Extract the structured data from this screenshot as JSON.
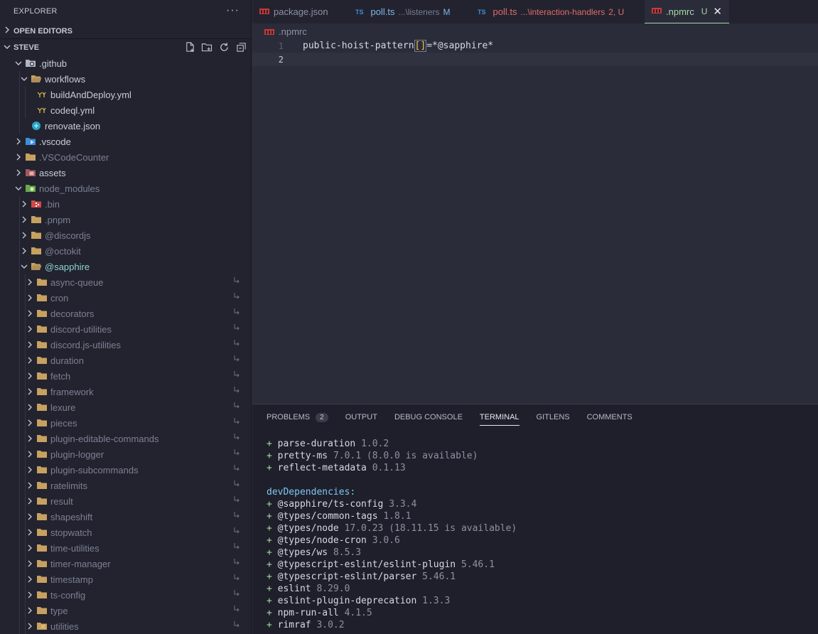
{
  "explorer": {
    "title": "EXPLORER",
    "more": "···",
    "open_editors": "OPEN EDITORS",
    "workspace": "STEVE"
  },
  "tree": [
    {
      "label": ".github",
      "depth": 0,
      "expanded": true,
      "kind": "folder-github",
      "style": "normal"
    },
    {
      "label": "workflows",
      "depth": 1,
      "expanded": true,
      "kind": "folder",
      "style": "normal"
    },
    {
      "label": "buildAndDeploy.yml",
      "depth": 2,
      "kind": "yaml",
      "style": "normal"
    },
    {
      "label": "codeql.yml",
      "depth": 2,
      "kind": "yaml",
      "style": "normal"
    },
    {
      "label": "renovate.json",
      "depth": 1,
      "kind": "renovate",
      "style": "normal"
    },
    {
      "label": ".vscode",
      "depth": 0,
      "expanded": false,
      "kind": "folder-vscode",
      "style": "normal"
    },
    {
      "label": ".VSCodeCounter",
      "depth": 0,
      "expanded": false,
      "kind": "folder",
      "style": "dim"
    },
    {
      "label": "assets",
      "depth": 0,
      "expanded": false,
      "kind": "folder-assets",
      "style": "normal"
    },
    {
      "label": "node_modules",
      "depth": 0,
      "expanded": true,
      "kind": "folder-node",
      "style": "dim"
    },
    {
      "label": ".bin",
      "depth": 1,
      "expanded": false,
      "kind": "folder-bin",
      "style": "dim"
    },
    {
      "label": ".pnpm",
      "depth": 1,
      "expanded": false,
      "kind": "folder",
      "style": "dim"
    },
    {
      "label": "@discordjs",
      "depth": 1,
      "expanded": false,
      "kind": "folder",
      "style": "dim"
    },
    {
      "label": "@octokit",
      "depth": 1,
      "expanded": false,
      "kind": "folder",
      "style": "dim"
    },
    {
      "label": "@sapphire",
      "depth": 1,
      "expanded": true,
      "kind": "folder",
      "style": "teal"
    },
    {
      "label": "async-queue",
      "depth": 2,
      "expanded": false,
      "kind": "folder",
      "style": "dim",
      "link": true
    },
    {
      "label": "cron",
      "depth": 2,
      "expanded": false,
      "kind": "folder",
      "style": "dim",
      "link": true
    },
    {
      "label": "decorators",
      "depth": 2,
      "expanded": false,
      "kind": "folder",
      "style": "dim",
      "link": true
    },
    {
      "label": "discord-utilities",
      "depth": 2,
      "expanded": false,
      "kind": "folder",
      "style": "dim",
      "link": true
    },
    {
      "label": "discord.js-utilities",
      "depth": 2,
      "expanded": false,
      "kind": "folder",
      "style": "dim",
      "link": true
    },
    {
      "label": "duration",
      "depth": 2,
      "expanded": false,
      "kind": "folder",
      "style": "dim",
      "link": true
    },
    {
      "label": "fetch",
      "depth": 2,
      "expanded": false,
      "kind": "folder",
      "style": "dim",
      "link": true
    },
    {
      "label": "framework",
      "depth": 2,
      "expanded": false,
      "kind": "folder",
      "style": "dim",
      "link": true
    },
    {
      "label": "lexure",
      "depth": 2,
      "expanded": false,
      "kind": "folder",
      "style": "dim",
      "link": true
    },
    {
      "label": "pieces",
      "depth": 2,
      "expanded": false,
      "kind": "folder",
      "style": "dim",
      "link": true
    },
    {
      "label": "plugin-editable-commands",
      "depth": 2,
      "expanded": false,
      "kind": "folder",
      "style": "dim",
      "link": true
    },
    {
      "label": "plugin-logger",
      "depth": 2,
      "expanded": false,
      "kind": "folder",
      "style": "dim",
      "link": true
    },
    {
      "label": "plugin-subcommands",
      "depth": 2,
      "expanded": false,
      "kind": "folder",
      "style": "dim",
      "link": true
    },
    {
      "label": "ratelimits",
      "depth": 2,
      "expanded": false,
      "kind": "folder",
      "style": "dim",
      "link": true
    },
    {
      "label": "result",
      "depth": 2,
      "expanded": false,
      "kind": "folder",
      "style": "dim",
      "link": true
    },
    {
      "label": "shapeshift",
      "depth": 2,
      "expanded": false,
      "kind": "folder",
      "style": "dim",
      "link": true
    },
    {
      "label": "stopwatch",
      "depth": 2,
      "expanded": false,
      "kind": "folder",
      "style": "dim",
      "link": true
    },
    {
      "label": "time-utilities",
      "depth": 2,
      "expanded": false,
      "kind": "folder",
      "style": "dim",
      "link": true
    },
    {
      "label": "timer-manager",
      "depth": 2,
      "expanded": false,
      "kind": "folder",
      "style": "dim",
      "link": true
    },
    {
      "label": "timestamp",
      "depth": 2,
      "expanded": false,
      "kind": "folder",
      "style": "dim",
      "link": true
    },
    {
      "label": "ts-config",
      "depth": 2,
      "expanded": false,
      "kind": "folder",
      "style": "dim",
      "link": true
    },
    {
      "label": "type",
      "depth": 2,
      "expanded": false,
      "kind": "folder",
      "style": "dim",
      "link": true
    },
    {
      "label": "utilities",
      "depth": 2,
      "expanded": false,
      "kind": "folder-utils",
      "style": "dim",
      "link": true
    }
  ],
  "tabs": [
    {
      "label": "package.json",
      "icon": "npm",
      "desc": "",
      "badge": "",
      "active": false
    },
    {
      "label": "poll.ts",
      "icon": "TS",
      "desc": "...\\listeners",
      "badge": "M",
      "active": false,
      "color": "#7fb6e8",
      "badge_color": "#7fb6e8"
    },
    {
      "label": "poll.ts",
      "icon": "TS",
      "desc": "...\\interaction-handlers",
      "badge": "2, U",
      "active": false,
      "color": "#e26b6b",
      "badge_color": "#e26b6b"
    },
    {
      "label": ".npmrc",
      "icon": "npm",
      "desc": "",
      "badge": "U",
      "active": true,
      "close": "✕"
    }
  ],
  "editor": {
    "breadcrumb": ".npmrc",
    "lines": [
      {
        "n": "1",
        "pre": "public-hoist-pattern",
        "bracket": "[]",
        "post": "=*@sapphire*"
      },
      {
        "n": "2",
        "pre": "",
        "bracket": "",
        "post": ""
      }
    ]
  },
  "panel": {
    "tabs": [
      {
        "label": "PROBLEMS",
        "count": "2"
      },
      {
        "label": "OUTPUT"
      },
      {
        "label": "DEBUG CONSOLE"
      },
      {
        "label": "TERMINAL",
        "active": true
      },
      {
        "label": "GITLENS"
      },
      {
        "label": "COMMENTS"
      }
    ],
    "terminal": [
      {
        "type": "pkg",
        "name": "parse-duration",
        "ver": "1.0.2"
      },
      {
        "type": "pkg",
        "name": "pretty-ms",
        "ver": "7.0.1 (8.0.0 is available)"
      },
      {
        "type": "pkg",
        "name": "reflect-metadata",
        "ver": "0.1.13"
      },
      {
        "type": "blank"
      },
      {
        "type": "head",
        "text": "devDependencies:"
      },
      {
        "type": "pkg",
        "name": "@sapphire/ts-config",
        "ver": "3.3.4"
      },
      {
        "type": "pkg",
        "name": "@types/common-tags",
        "ver": "1.8.1"
      },
      {
        "type": "pkg",
        "name": "@types/node",
        "ver": "17.0.23 (18.11.15 is available)"
      },
      {
        "type": "pkg",
        "name": "@types/node-cron",
        "ver": "3.0.6"
      },
      {
        "type": "pkg",
        "name": "@types/ws",
        "ver": "8.5.3"
      },
      {
        "type": "pkg",
        "name": "@typescript-eslint/eslint-plugin",
        "ver": "5.46.1"
      },
      {
        "type": "pkg",
        "name": "@typescript-eslint/parser",
        "ver": "5.46.1"
      },
      {
        "type": "pkg",
        "name": "eslint",
        "ver": "8.29.0"
      },
      {
        "type": "pkg",
        "name": "eslint-plugin-deprecation",
        "ver": "1.3.3"
      },
      {
        "type": "pkg",
        "name": "npm-run-all",
        "ver": "4.1.5"
      },
      {
        "type": "pkg",
        "name": "rimraf",
        "ver": "3.0.2"
      }
    ]
  }
}
